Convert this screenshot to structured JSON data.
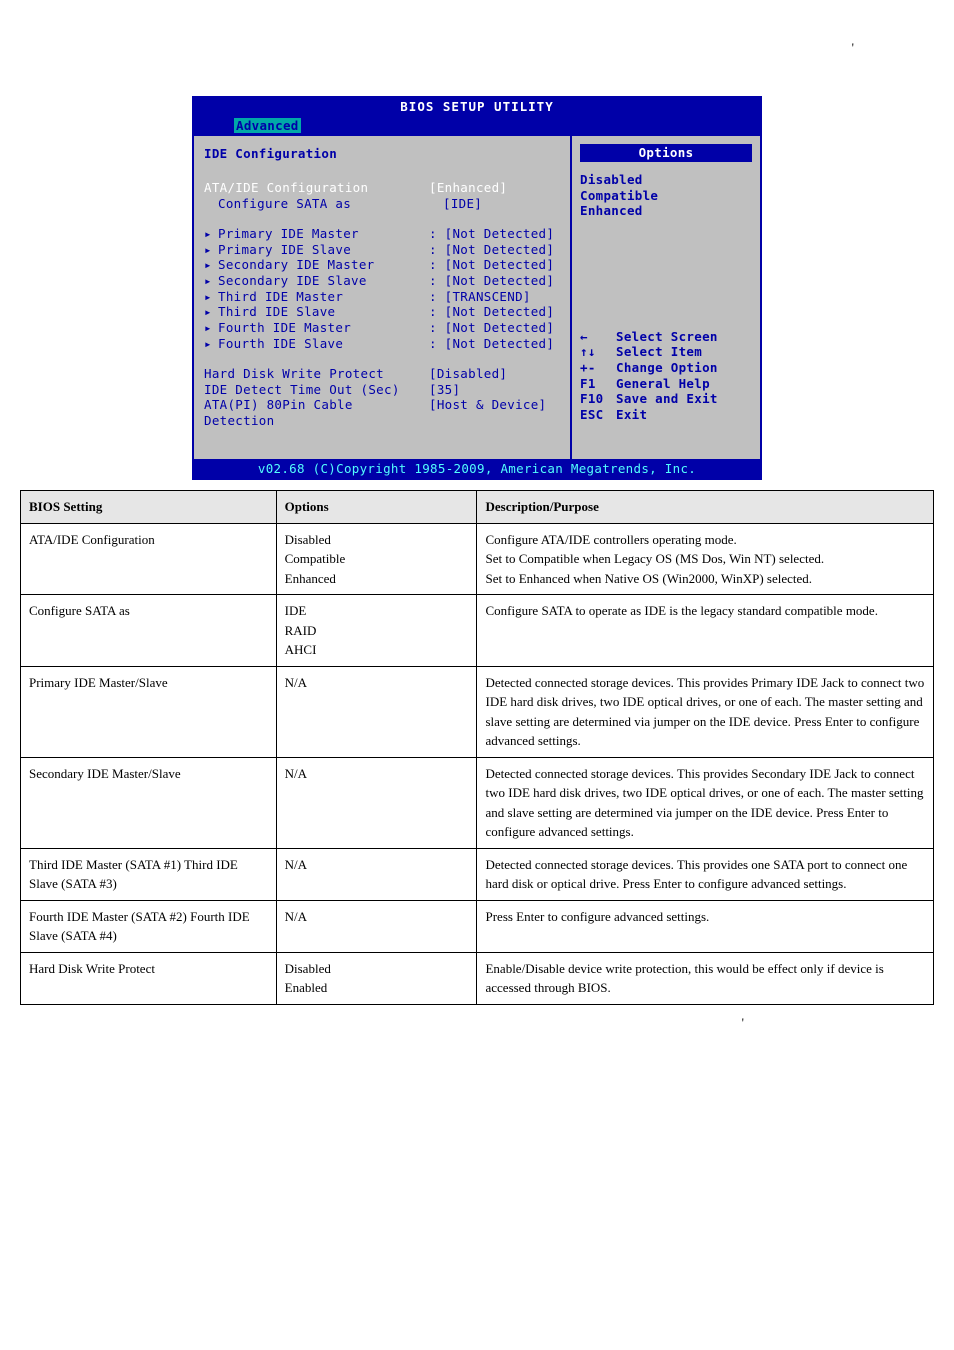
{
  "stray": {
    "top": "'",
    "bottom": "'"
  },
  "bios": {
    "title": "BIOS SETUP UTILITY",
    "tab": "Advanced",
    "section_heading": "IDE Configuration",
    "rows": {
      "ata_ide_cfg": {
        "label": "ATA/IDE Configuration",
        "value": "[Enhanced]"
      },
      "cfg_sata": {
        "label": "Configure SATA as",
        "value": "[IDE]"
      },
      "pmaster": {
        "label": "Primary IDE Master",
        "value": ": [Not Detected]"
      },
      "pslave": {
        "label": "Primary IDE Slave",
        "value": ": [Not Detected]"
      },
      "smaster": {
        "label": "Secondary IDE Master",
        "value": ": [Not Detected]"
      },
      "sslave": {
        "label": "Secondary IDE Slave",
        "value": ": [Not Detected]"
      },
      "tmaster": {
        "label": "Third IDE Master",
        "value": ": [TRANSCEND]"
      },
      "tslave": {
        "label": "Third IDE Slave",
        "value": ": [Not Detected]"
      },
      "fmaster": {
        "label": "Fourth IDE Master",
        "value": ": [Not Detected]"
      },
      "fslave": {
        "label": "Fourth IDE Slave",
        "value": ": [Not Detected]"
      },
      "hdwp": {
        "label": "Hard Disk Write Protect",
        "value": "[Disabled]"
      },
      "idedet": {
        "label": "IDE Detect Time Out (Sec)",
        "value": "[35]"
      },
      "atapi": {
        "label": "ATA(PI) 80Pin Cable Detection",
        "value": "[Host & Device]"
      }
    },
    "options_title": "Options",
    "options": {
      "o1": "Disabled",
      "o2": "Compatible",
      "o3": "Enhanced"
    },
    "help": {
      "select_screen": {
        "key": "←",
        "label": "Select Screen"
      },
      "select_item": {
        "key": "↑↓",
        "label": "Select Item"
      },
      "change_option": {
        "key": "+-",
        "label": "Change Option"
      },
      "general_help": {
        "key": "F1",
        "label": "General Help"
      },
      "save_exit": {
        "key": "F10",
        "label": "Save and Exit"
      },
      "exit": {
        "key": "ESC",
        "label": "Exit"
      }
    },
    "footer": "v02.68 (C)Copyright 1985-2009, American Megatrends, Inc."
  },
  "table": {
    "header": {
      "c1": "BIOS Setting",
      "c2": "Options",
      "c3": "Description/Purpose"
    },
    "rows": [
      {
        "setting": "ATA/IDE Configuration",
        "options": "Disabled\nCompatible\nEnhanced",
        "desc": "Configure ATA/IDE controllers operating mode.\nSet to Compatible when Legacy OS (MS Dos, Win NT) selected.\nSet to Enhanced when Native OS (Win2000, WinXP) selected."
      },
      {
        "setting": "Configure SATA as",
        "options": "IDE\nRAID\nAHCI",
        "desc": "Configure SATA to operate as IDE is the legacy standard compatible mode."
      },
      {
        "setting": "Primary IDE Master/Slave",
        "options": "N/A",
        "desc": "Detected connected storage devices. This provides Primary IDE Jack to connect two IDE hard disk drives, two IDE optical drives, or one of each. The master setting and slave setting are determined via jumper on the IDE device. Press Enter to configure advanced settings."
      },
      {
        "setting": "Secondary IDE Master/Slave",
        "options": "N/A",
        "desc": "Detected connected storage devices. This provides Secondary IDE Jack to connect two IDE hard disk drives, two IDE optical drives, or one of each. The master setting and slave setting are determined via jumper on the IDE device. Press Enter to configure advanced settings."
      },
      {
        "setting": "Third IDE Master (SATA #1) Third IDE Slave (SATA #3)",
        "options": "N/A",
        "desc": "Detected connected storage devices. This provides one SATA port to connect one hard disk or optical drive. Press Enter to configure advanced settings."
      },
      {
        "setting": "Fourth IDE Master (SATA #2) Fourth IDE Slave (SATA #4)",
        "options": "N/A",
        "desc": "Press Enter to configure advanced settings."
      },
      {
        "setting": "Hard Disk Write Protect",
        "options": "Disabled\nEnabled",
        "desc": "Enable/Disable device write protection, this would be effect only if device is accessed through BIOS."
      }
    ]
  }
}
